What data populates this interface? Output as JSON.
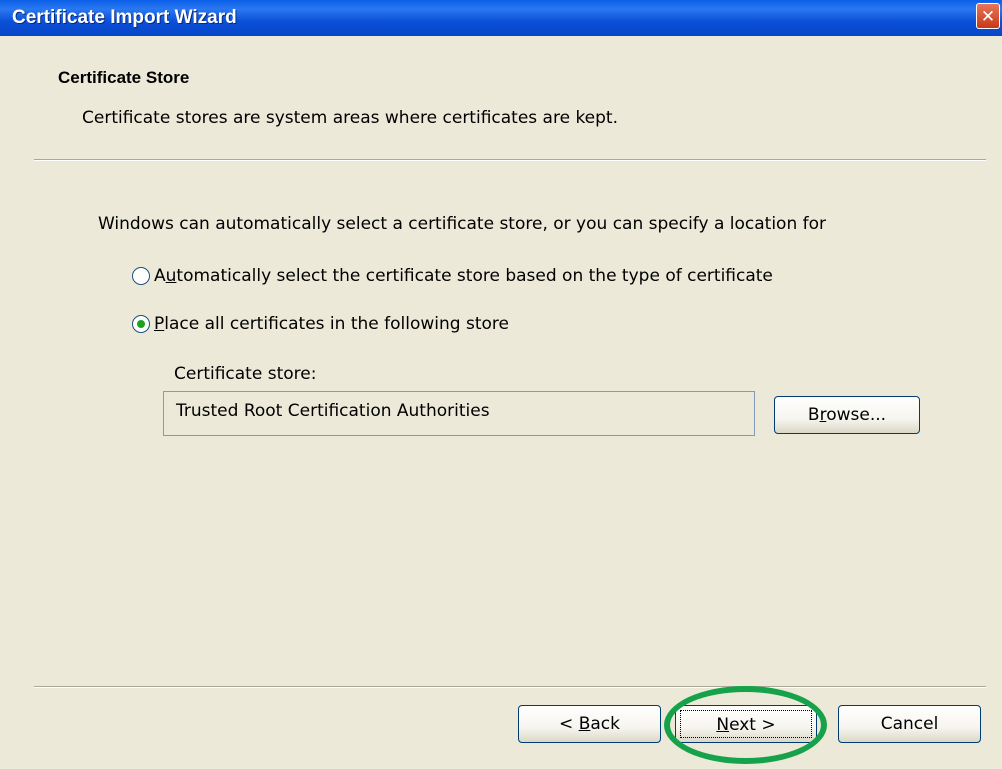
{
  "window": {
    "title": "Certificate Import Wizard",
    "close_glyph": "✕"
  },
  "header": {
    "title": "Certificate Store",
    "subtitle": "Certificate stores are system areas where certificates are kept."
  },
  "body": {
    "intro": "Windows can automatically select a certificate store, or you can specify a location for",
    "options": [
      {
        "pre": "A",
        "accel": "u",
        "post": "tomatically select the certificate store based on the type of certificate",
        "selected": false
      },
      {
        "pre": "",
        "accel": "P",
        "post": "lace all certificates in the following store",
        "selected": true
      }
    ],
    "store_label": "Certificate store:",
    "store_value": "Trusted Root Certification Authorities",
    "browse": {
      "pre": "B",
      "accel": "r",
      "post": "owse..."
    }
  },
  "footer": {
    "back": {
      "pre": "< ",
      "accel": "B",
      "post": "ack"
    },
    "next": {
      "pre": "",
      "accel": "N",
      "post": "ext >"
    },
    "cancel": "Cancel"
  },
  "colors": {
    "title_bar": "#0a5fe8",
    "dialog_bg": "#ece9d8",
    "radio_dot": "#21a121",
    "highlight_ring": "#16a24a"
  },
  "icons": {
    "close": "close-icon",
    "radio": "radio-icon"
  }
}
